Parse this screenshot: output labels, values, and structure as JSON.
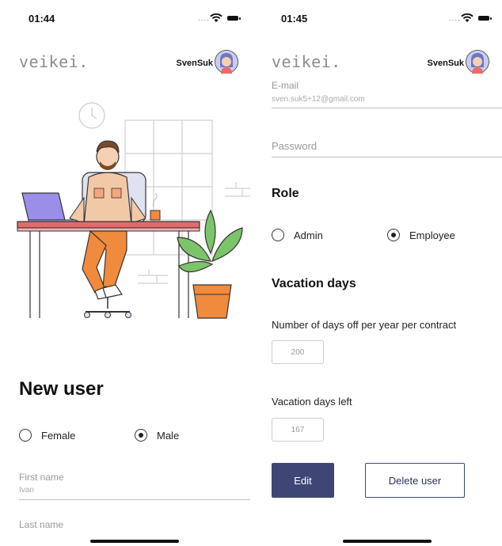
{
  "left": {
    "status_time": "01:44",
    "logo": "veikei.",
    "username": "SvenSuk",
    "title": "New user",
    "gender": {
      "options": [
        {
          "label": "Female",
          "selected": false
        },
        {
          "label": "Male",
          "selected": true
        }
      ]
    },
    "first_name": {
      "label": "First name",
      "value": "Ivan"
    },
    "last_name": {
      "label": "Last name",
      "value": ""
    }
  },
  "right": {
    "status_time": "01:45",
    "status_signal": "....",
    "logo": "veikei.",
    "username": "SvenSuk",
    "email": {
      "label": "E-mail",
      "value": "sven.suk5+12@gmail.com"
    },
    "password": {
      "placeholder": "Password"
    },
    "role": {
      "heading": "Role",
      "options": [
        {
          "label": "Admin",
          "selected": false
        },
        {
          "label": "Employee",
          "selected": true
        }
      ]
    },
    "vacation": {
      "heading": "Vacation days",
      "per_year_label": "Number of days off per year per contract",
      "per_year_value": "200",
      "left_label": "Vacation days left",
      "left_value": "167"
    },
    "edit_label": "Edit",
    "delete_label": "Delete user"
  },
  "status_signal": "....",
  "colors": {
    "primary": "#3e4676",
    "logo_gray": "#8c8c8c",
    "illustration_orange": "#f08a3c",
    "illustration_green": "#7cc46a"
  }
}
